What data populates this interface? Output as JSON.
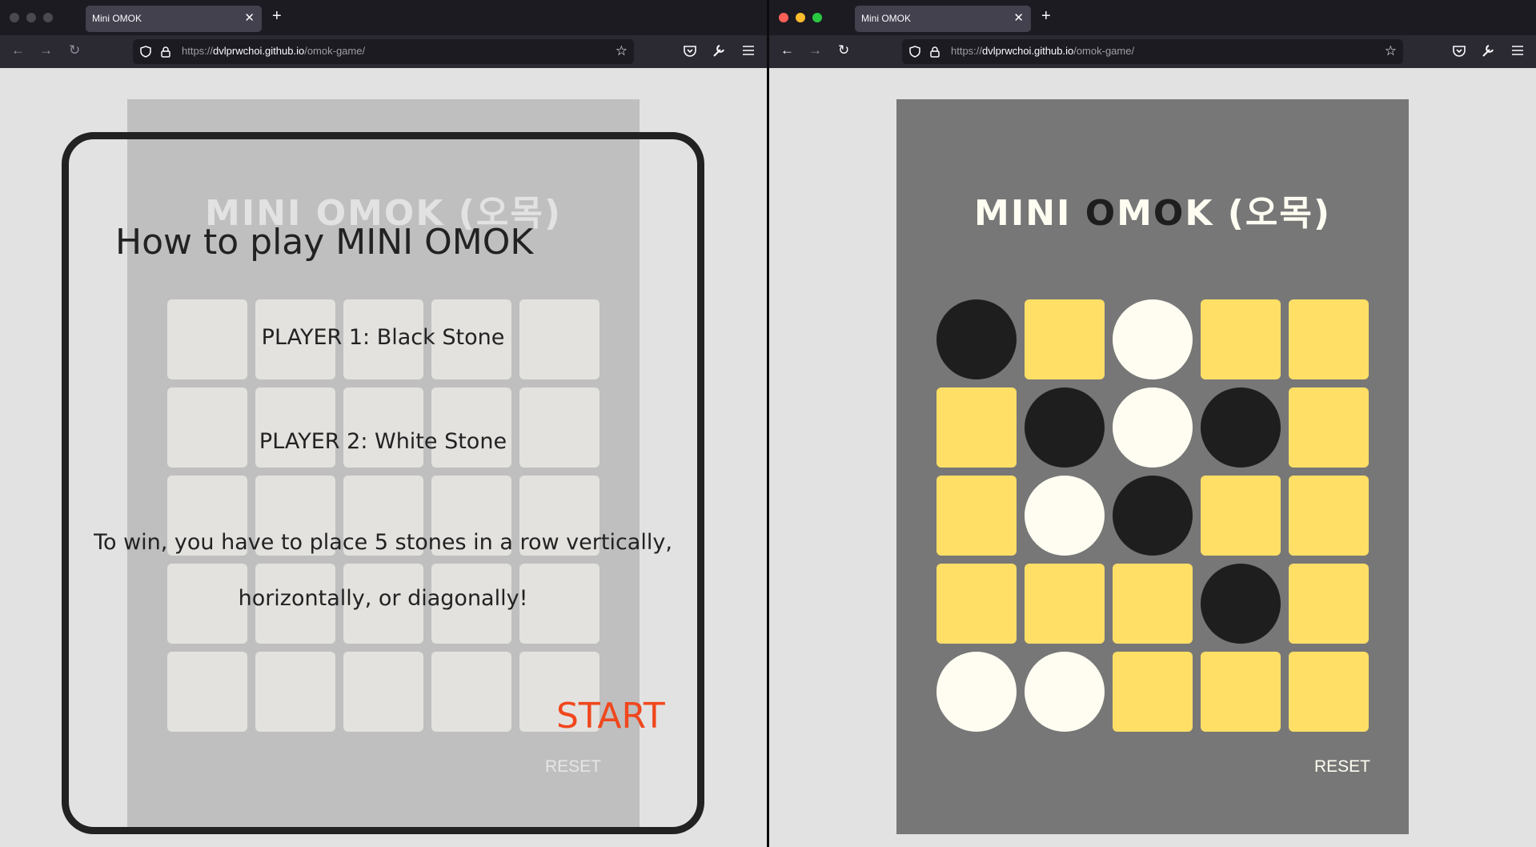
{
  "browser": {
    "tab_title": "Mini OMOK",
    "url_prefix": "https://",
    "url_host": "dvlprwchoi.github.io",
    "url_path": "/omok-game/",
    "tab_close": "✕",
    "new_tab": "+",
    "back": "←",
    "forward": "→",
    "reload": "↻",
    "star": "☆"
  },
  "game": {
    "title_prefix": "MINI ",
    "title_o1": "O",
    "title_m": "M",
    "title_o2": "O",
    "title_k": "K",
    "title_suffix": " (오목)",
    "reset_label": "RESET",
    "board_left": [
      [
        "empty",
        "empty",
        "empty",
        "empty",
        "empty"
      ],
      [
        "empty",
        "empty",
        "empty",
        "empty",
        "empty"
      ],
      [
        "empty",
        "empty",
        "empty",
        "empty",
        "empty"
      ],
      [
        "empty",
        "empty",
        "empty",
        "empty",
        "empty"
      ],
      [
        "empty",
        "empty",
        "empty",
        "empty",
        "empty"
      ]
    ],
    "board_right": [
      [
        "black",
        "empty",
        "white",
        "empty",
        "empty"
      ],
      [
        "empty",
        "black",
        "white",
        "black",
        "empty"
      ],
      [
        "empty",
        "white",
        "black",
        "empty",
        "empty"
      ],
      [
        "empty",
        "empty",
        "empty",
        "black",
        "empty"
      ],
      [
        "white",
        "white",
        "empty",
        "empty",
        "empty"
      ]
    ]
  },
  "modal": {
    "title": "How to play MINI OMOK",
    "player1": "PLAYER 1: Black Stone",
    "player2": "PLAYER 2: White Stone",
    "rule_line1": "To win, you have to place 5 stones in a row vertically,",
    "rule_line2": "horizontally, or diagonally!",
    "start_label": "START"
  },
  "colors": {
    "board_bg": "#777777",
    "empty_cell": "#ffdf66",
    "black_stone": "#1e1e1e",
    "white_stone": "#fffdf2",
    "start": "#f0471d"
  }
}
